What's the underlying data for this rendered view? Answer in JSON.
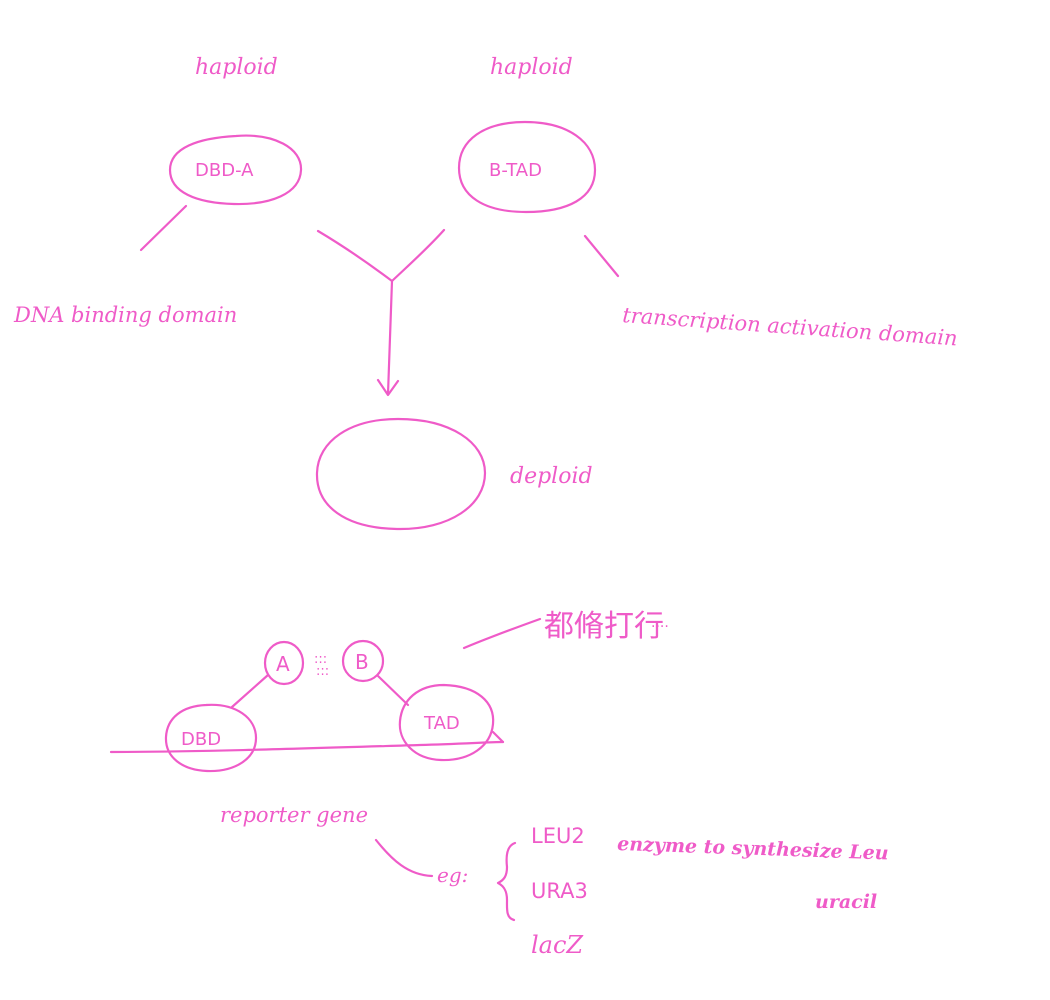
{
  "colors": {
    "ink": "#ef5bc8",
    "background": "#ffffff"
  },
  "top": {
    "left_ploidy": "haploid",
    "right_ploidy": "haploid",
    "left_cell_label": "DBD-A",
    "right_cell_label": "B-TAD",
    "left_domain_note": "DNA binding domain",
    "right_domain_note": "transcription activation domain",
    "merged_cell_label": "deploid"
  },
  "bottom": {
    "protein_a": "A",
    "protein_b": "B",
    "interaction_symbol": ":::",
    "dbd_label": "DBD",
    "tad_label": "TAD",
    "chinese_note": "都脩打行",
    "ellipsis": "····",
    "reporter_label": "reporter gene",
    "eg_label": "eg:",
    "genes": [
      {
        "name": "LEU2",
        "description": "enzyme to synthesize Leu"
      },
      {
        "name": "URA3",
        "description": "uracil"
      },
      {
        "name": "lacZ",
        "description": ""
      }
    ]
  }
}
